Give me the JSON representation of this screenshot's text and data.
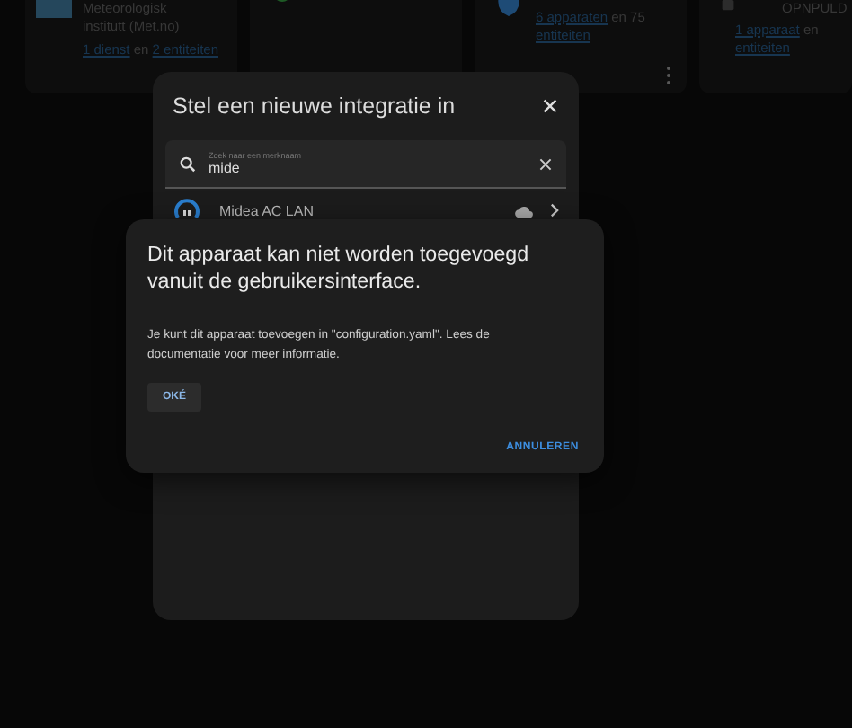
{
  "cards": [
    {
      "kind": "logo",
      "lines": [
        "Meteorologisk",
        "institutt (Met.no)"
      ],
      "links": [
        {
          "text": "1 dienst",
          "kind": "link"
        },
        {
          "text": " en ",
          "kind": "plain"
        },
        {
          "text": "2 entiteiten",
          "kind": "link"
        }
      ],
      "menu": false
    },
    {
      "kind": "green",
      "menu": false
    },
    {
      "kind": "blue",
      "links": [
        {
          "text": "6 apparaten",
          "kind": "link"
        },
        {
          "text": " en 75 ",
          "kind": "plain"
        },
        {
          "text": "entiteiten",
          "kind": "link"
        }
      ],
      "menu": true
    },
    {
      "kind": "grey",
      "lines": [
        "OPNPULD"
      ],
      "links": [
        {
          "text": "1 apparaat",
          "kind": "link"
        },
        {
          "text": " en ",
          "kind": "plain"
        },
        {
          "text": "entiteiten",
          "kind": "link"
        }
      ],
      "menu": false
    }
  ],
  "integration_dialog": {
    "title": "Stel een nieuwe integratie in",
    "search": {
      "placeholder": "Zoek naar een merknaam",
      "value": "mide"
    },
    "results": [
      {
        "name": "Midea AC LAN"
      }
    ]
  },
  "alert": {
    "title": "Dit apparaat kan niet worden toegevoegd vanuit de gebruikersinterface.",
    "body": "Je kunt dit apparaat toevoegen in \"configuration.yaml\". Lees de documentatie voor meer informatie.",
    "ok": "OKÉ",
    "cancel": "ANNULEREN"
  }
}
